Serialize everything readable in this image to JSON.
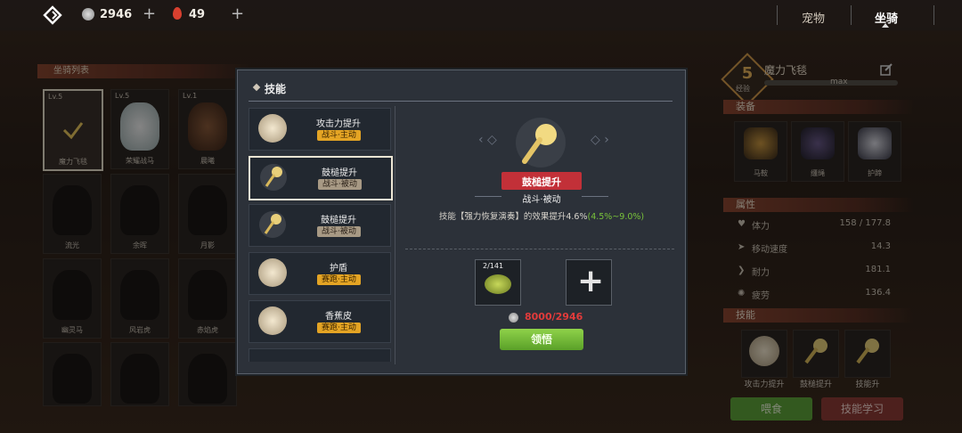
{
  "topbar": {
    "coins": "2946",
    "gems": "49",
    "tabs": [
      "宠物",
      "坐骑"
    ],
    "active_tab": "坐骑"
  },
  "mount_list": {
    "title": "坐骑列表",
    "cells": [
      {
        "lv": "Lv.5",
        "name": "魔力飞毯"
      },
      {
        "lv": "Lv.5",
        "name": "荣耀战马"
      },
      {
        "lv": "Lv.1",
        "name": "晨曦"
      },
      {
        "lv": "",
        "name": "流光"
      },
      {
        "lv": "",
        "name": "余晖"
      },
      {
        "lv": "",
        "name": "月影"
      },
      {
        "lv": "",
        "name": "幽灵马"
      },
      {
        "lv": "",
        "name": "风岩虎"
      },
      {
        "lv": "",
        "name": "赤焰虎"
      },
      {
        "lv": "",
        "name": ""
      },
      {
        "lv": "",
        "name": ""
      },
      {
        "lv": "",
        "name": ""
      }
    ]
  },
  "modal": {
    "title": "技能",
    "skills": [
      {
        "name": "攻击力提升",
        "tag": "战斗·主动",
        "kind": "act"
      },
      {
        "name": "鼓槌提升",
        "tag": "战斗·被动",
        "kind": "pas"
      },
      {
        "name": "鼓槌提升",
        "tag": "战斗·被动",
        "kind": "pas"
      },
      {
        "name": "护盾",
        "tag": "赛跑·主动",
        "kind": "act"
      },
      {
        "name": "香蕉皮",
        "tag": "赛跑·主动",
        "kind": "act"
      }
    ],
    "detail": {
      "name": "鼓槌提升",
      "type": "战斗·被动",
      "desc": "技能【强力恢复演奏】的效果提升4.6%",
      "desc_range": "(4.5%~9.0%)",
      "material_count": "2/141",
      "cost": "8000/2946",
      "learn_button": "领悟"
    }
  },
  "right_panel": {
    "level": "5",
    "mount_name": "魔力飞毯",
    "exp_label": "经验",
    "max_label": "max",
    "equip_title": "装备",
    "equip": [
      "马鞍",
      "缰绳",
      "护蹄"
    ],
    "attr_title": "属性",
    "stats": [
      {
        "label": "体力",
        "value": "158 / 177.8"
      },
      {
        "label": "移动速度",
        "value": "14.3"
      },
      {
        "label": "耐力",
        "value": "181.1"
      },
      {
        "label": "疲劳",
        "value": "136.4"
      }
    ],
    "skill_title": "技能",
    "skills": [
      "攻击力提升",
      "鼓槌提升",
      "技能升"
    ],
    "feed_button": "喂食",
    "learn_button": "技能学习"
  },
  "colors": {
    "accent_red": "#c23038",
    "active_green": "#79c33a",
    "cost_red": "#e23b3b"
  }
}
